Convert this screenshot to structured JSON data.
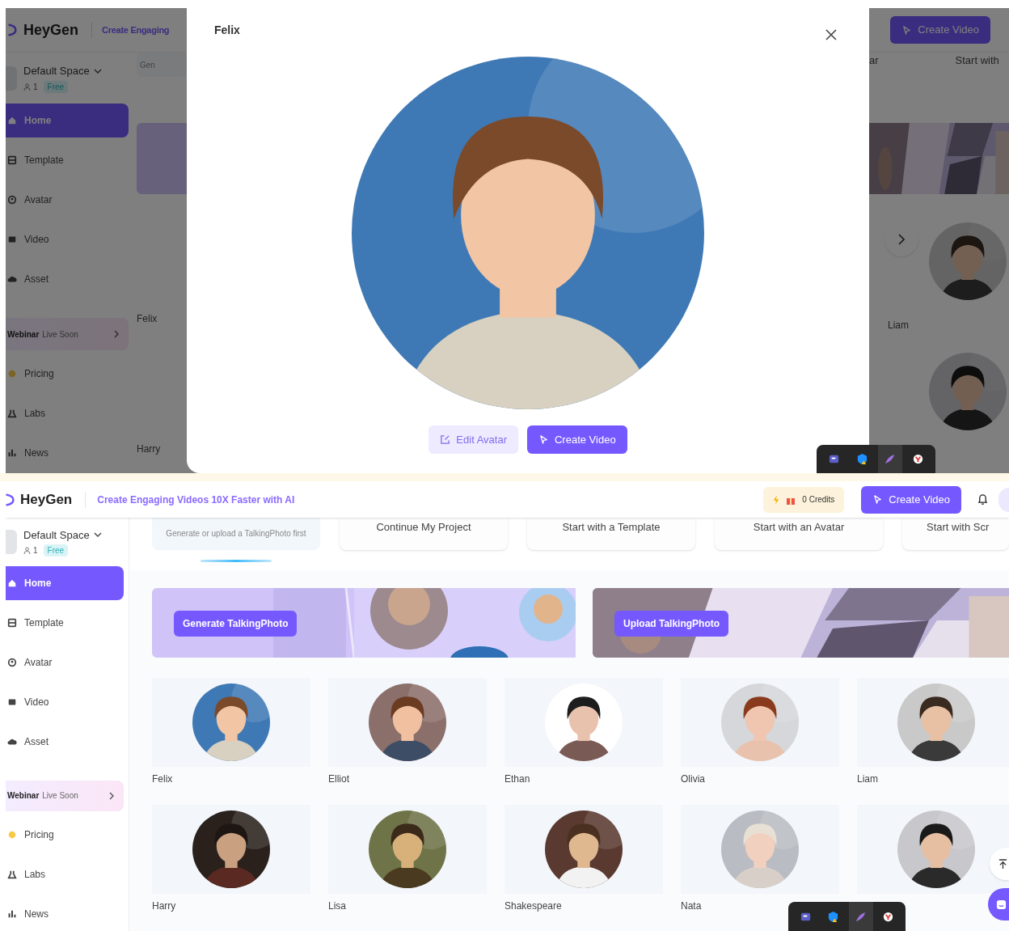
{
  "top_view": {
    "header": {
      "logo": "HeyGen",
      "tagline": "Create Engaging",
      "create_button": "Create Video"
    },
    "workspace": {
      "name": "Default Space",
      "members": "1",
      "plan": "Free"
    },
    "nav_items": [
      {
        "label": "Home",
        "selected": true
      },
      {
        "label": "Template",
        "selected": false
      },
      {
        "label": "Avatar",
        "selected": false
      },
      {
        "label": "Video",
        "selected": false
      },
      {
        "label": "Asset",
        "selected": false
      }
    ],
    "webinar": {
      "title": "Webinar",
      "note": "Live Soon"
    },
    "more_items": [
      {
        "label": "Pricing"
      },
      {
        "label": "Labs"
      },
      {
        "label": "News"
      }
    ],
    "left_column": {
      "cut_text": "Gen",
      "names": [
        "Felix",
        "Harry"
      ]
    },
    "right_column": {
      "cut_texts": [
        "ar",
        "Start with"
      ],
      "names": [
        "Liam"
      ]
    },
    "modal": {
      "title": "Felix",
      "buttons": [
        {
          "label": "Edit Avatar",
          "kind": "secondary"
        },
        {
          "label": "Create Video",
          "kind": "primary"
        }
      ]
    }
  },
  "bottom_view": {
    "header": {
      "logo": "HeyGen",
      "tagline": "Create Engaging Videos 10X Faster with AI",
      "credits": "0 Credits",
      "create_button": "Create Video"
    },
    "workspace": {
      "name": "Default Space",
      "members": "1",
      "plan": "Free"
    },
    "nav_items": [
      {
        "label": "Home",
        "selected": true
      },
      {
        "label": "Template",
        "selected": false
      },
      {
        "label": "Avatar",
        "selected": false
      },
      {
        "label": "Video",
        "selected": false
      },
      {
        "label": "Asset",
        "selected": false
      }
    ],
    "webinar": {
      "title": "Webinar",
      "note": "Live Soon"
    },
    "more_items": [
      {
        "label": "Pricing"
      },
      {
        "label": "Labs"
      },
      {
        "label": "News"
      }
    ],
    "quick_actions": [
      {
        "subtitle": "Generate or upload a TalkingPhoto first",
        "selected": true
      },
      {
        "title": "Continue My Project",
        "selected": false
      },
      {
        "title": "Start with a Template",
        "selected": false
      },
      {
        "title": "Start with an Avatar",
        "selected": false
      },
      {
        "title": "Start with Scr",
        "selected": false
      }
    ],
    "banners": [
      {
        "button": "Generate TalkingPhoto"
      },
      {
        "button": "Upload TalkingPhoto"
      }
    ],
    "avatars": [
      {
        "name": "Felix",
        "kind": "picture"
      },
      {
        "name": "Elliot",
        "kind": "picture"
      },
      {
        "name": "Ethan",
        "kind": "picture"
      },
      {
        "name": "Olivia",
        "kind": "picture"
      },
      {
        "name": "Liam",
        "kind": "picture"
      },
      {
        "name": "Harry",
        "kind": "picture"
      },
      {
        "name": "Lisa",
        "kind": "picture"
      },
      {
        "name": "Shakespeare",
        "kind": "picture"
      },
      {
        "name": "Nata",
        "kind": "picture"
      },
      {
        "kind": "picture"
      }
    ]
  }
}
